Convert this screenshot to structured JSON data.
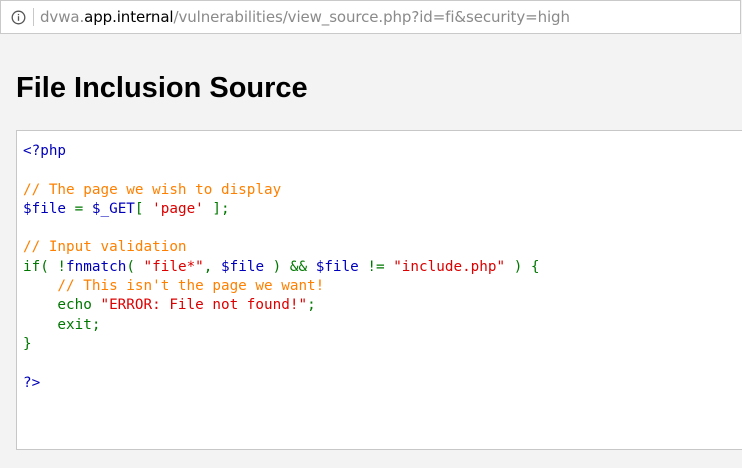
{
  "browser": {
    "url_prefix": "dvwa.",
    "url_host": "app.internal",
    "url_path": "/vulnerabilities/view_source.php?id=fi&security=high",
    "info_icon": "info-circle-icon"
  },
  "page": {
    "title": "File Inclusion Source"
  },
  "source": {
    "lines": [
      [
        {
          "t": "<?php",
          "c": "k"
        }
      ],
      [],
      [
        {
          "t": "// The page we wish to display",
          "c": "c"
        }
      ],
      [
        {
          "t": "$file",
          "c": "k"
        },
        {
          "t": " = ",
          "c": "g"
        },
        {
          "t": "$_GET",
          "c": "k"
        },
        {
          "t": "[ ",
          "c": "g"
        },
        {
          "t": "'page'",
          "c": "s"
        },
        {
          "t": " ];",
          "c": "g"
        }
      ],
      [],
      [
        {
          "t": "// Input validation",
          "c": "c"
        }
      ],
      [
        {
          "t": "if( !",
          "c": "g"
        },
        {
          "t": "fnmatch",
          "c": "k"
        },
        {
          "t": "( ",
          "c": "g"
        },
        {
          "t": "\"file*\"",
          "c": "s"
        },
        {
          "t": ", ",
          "c": "g"
        },
        {
          "t": "$file",
          "c": "k"
        },
        {
          "t": " ) && ",
          "c": "g"
        },
        {
          "t": "$file",
          "c": "k"
        },
        {
          "t": " != ",
          "c": "g"
        },
        {
          "t": "\"include.php\"",
          "c": "s"
        },
        {
          "t": " ) {",
          "c": "g"
        }
      ],
      [
        {
          "t": "    // This isn't the page we want!",
          "c": "c"
        }
      ],
      [
        {
          "t": "    echo ",
          "c": "g"
        },
        {
          "t": "\"ERROR: File not found!\"",
          "c": "s"
        },
        {
          "t": ";",
          "c": "g"
        }
      ],
      [
        {
          "t": "    exit;",
          "c": "g"
        }
      ],
      [
        {
          "t": "}",
          "c": "g"
        }
      ],
      [],
      [
        {
          "t": "?>",
          "c": "k"
        }
      ]
    ]
  }
}
